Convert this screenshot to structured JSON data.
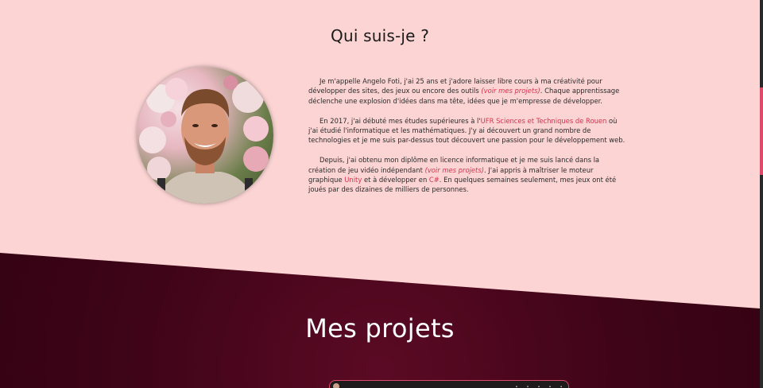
{
  "about": {
    "title": "Qui suis-je ?",
    "p1_a": "Je m'appelle Angelo Foti, j'ai 25 ans et j'adore laisser libre cours à ma créativité pour développer des sites, des jeux ou encore des outils ",
    "p1_link": "(voir mes projets)",
    "p1_b": ". Chaque apprentissage déclenche une explosion d'idées dans ma tête, idées que je m'empresse de développer.",
    "p2_a": "En 2017, j'ai débuté mes études supérieures à l'",
    "p2_link": "UFR Sciences et Techniques de Rouen",
    "p2_b": " où j'ai étudié l'informatique et les mathématiques. J'y ai découvert un grand nombre de technologies et je me suis par-dessus tout découvert une passion pour le développement web.",
    "p3_a": "Depuis, j'ai obtenu mon diplôme en licence informatique et je me suis lancé dans la création de jeu vidéo indépendant ",
    "p3_link": "(voir mes projets)",
    "p3_b": ". J'ai appris à maîtriser le moteur graphique ",
    "p3_unity": "Unity",
    "p3_c": " et à développer en ",
    "p3_csharp": "C#",
    "p3_d": ". En quelques semaines seulement, mes jeux ont été joués par des dizaines de milliers de personnes."
  },
  "projects": {
    "title": "Mes projets"
  },
  "colors": {
    "background": "#fcd4d4",
    "accent": "#d4334c",
    "dark_section": "#3f0418"
  }
}
